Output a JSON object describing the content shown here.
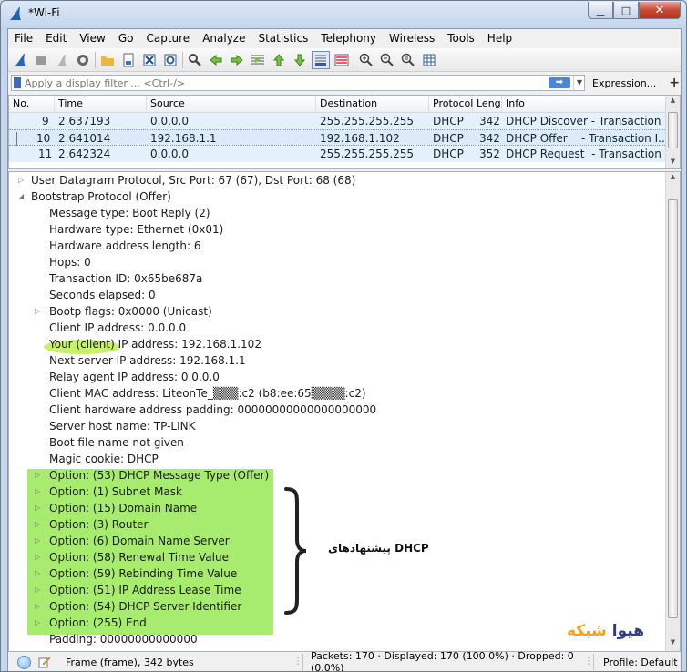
{
  "window": {
    "title": "*Wi-Fi",
    "min_glyph": "▁",
    "max_glyph": "□",
    "close_glyph": "✕"
  },
  "menu": [
    "File",
    "Edit",
    "View",
    "Go",
    "Capture",
    "Analyze",
    "Statistics",
    "Telephony",
    "Wireless",
    "Tools",
    "Help"
  ],
  "filter": {
    "placeholder": "Apply a display filter ... <Ctrl-/>",
    "apply_glyph": "➡",
    "dropdown_glyph": "▼",
    "expression_label": "Expression...",
    "add_label": "+"
  },
  "packet_list": {
    "columns": [
      "No.",
      "Time",
      "Source",
      "Destination",
      "Protocol",
      "Leng",
      "Info"
    ],
    "rows": [
      {
        "no": "9",
        "time": "2.637193",
        "source": "0.0.0.0",
        "destination": "255.255.255.255",
        "protocol": "DHCP",
        "length": "342",
        "info": "DHCP Discover - Transaction ..."
      },
      {
        "no": "10",
        "time": "2.641014",
        "source": "192.168.1.1",
        "destination": "192.168.1.102",
        "protocol": "DHCP",
        "length": "342",
        "info": "DHCP Offer    - Transaction I..."
      },
      {
        "no": "11",
        "time": "2.642324",
        "source": "0.0.0.0",
        "destination": "255.255.255.255",
        "protocol": "DHCP",
        "length": "352",
        "info": "DHCP Request  - Transaction ..."
      }
    ]
  },
  "details": {
    "collapsed_glyph": "▷",
    "expanded_glyph": "◢",
    "udp": "User Datagram Protocol, Src Port: 67 (67), Dst Port: 68 (68)",
    "bootp": "Bootstrap Protocol (Offer)",
    "fields": [
      "Message type: Boot Reply (2)",
      "Hardware type: Ethernet (0x01)",
      "Hardware address length: 6",
      "Hops: 0",
      "Transaction ID: 0x65be687a",
      "Seconds elapsed: 0"
    ],
    "bootp_flags": "Bootp flags: 0x0000 (Unicast)",
    "fields2": [
      "Client IP address: 0.0.0.0",
      "Your (client) IP address: 192.168.1.102",
      "Next server IP address: 192.168.1.1",
      "Relay agent IP address: 0.0.0.0",
      "Client MAC address: LiteonTe_▒▒▒:c2 (b8:ee:65▒▒▒▒:c2)",
      "Client hardware address padding: 00000000000000000000",
      "Server host name: TP-LINK",
      "Boot file name not given",
      "Magic cookie: DHCP"
    ],
    "options": [
      "Option: (53) DHCP Message Type (Offer)",
      "Option: (1) Subnet Mask",
      "Option: (15) Domain Name",
      "Option: (3) Router",
      "Option: (6) Domain Name Server",
      "Option: (58) Renewal Time Value",
      "Option: (59) Rebinding Time Value",
      "Option: (51) IP Address Lease Time",
      "Option: (54) DHCP Server Identifier",
      "Option: (255) End"
    ],
    "padding": "Padding: 00000000000000"
  },
  "annotation": {
    "text": "پیشنهادهای DHCP"
  },
  "logo": {
    "part1": "هیوا",
    "part2": "شبکه"
  },
  "status": {
    "frame": "Frame (frame), 342 bytes",
    "packets": "Packets: 170 · Displayed: 170 (100.0%) · Dropped: 0 (0.0%)",
    "profile": "Profile: Default"
  },
  "colors": {
    "highlight_green": "#a8ec6f",
    "row_blue": "#e4f0fa",
    "accent": "#4d86d6"
  }
}
